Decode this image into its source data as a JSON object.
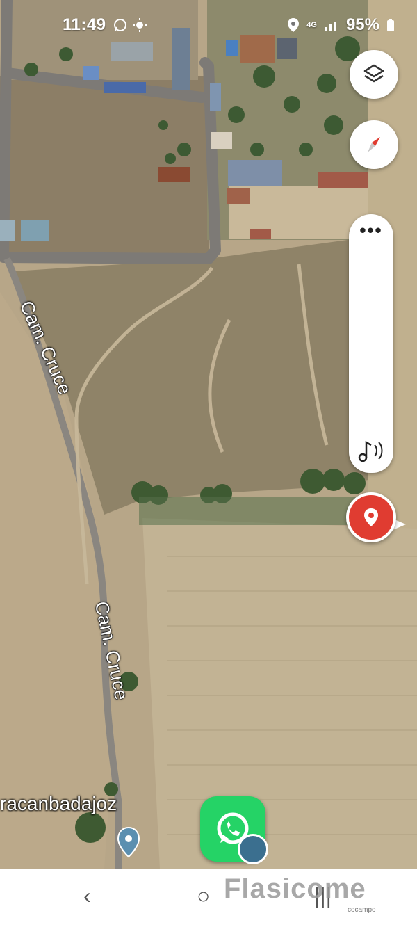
{
  "status_bar": {
    "time": "11:49",
    "network": "4G",
    "battery": "95%",
    "icons": [
      "whatsapp-icon",
      "sun-icon",
      "location-icon",
      "signal-icon",
      "battery-icon"
    ]
  },
  "map": {
    "road_labels": [
      "Cam. Cruce",
      "Cam. Cruce"
    ],
    "place_label": "racanbadajoz",
    "colors": {
      "road": "#7d7a76",
      "field": "#b7a688",
      "dry_grass": "#8f8368",
      "trees": "#3e5a32"
    }
  },
  "controls": {
    "layers_icon": "layers-icon",
    "compass_icon": "compass-icon",
    "more_icon": "more-dots-icon",
    "audio_icon": "music-note-icon",
    "location_pin_icon": "location-pin-icon",
    "pin_color": "#e03c31"
  },
  "app_shortcut": {
    "icon": "whatsapp-icon",
    "color": "#25d366"
  },
  "navigation_bar": {
    "back": "‹",
    "home": "○",
    "recents": "|||"
  },
  "watermark": {
    "text": "Flasicome",
    "sub": "cocampo"
  }
}
